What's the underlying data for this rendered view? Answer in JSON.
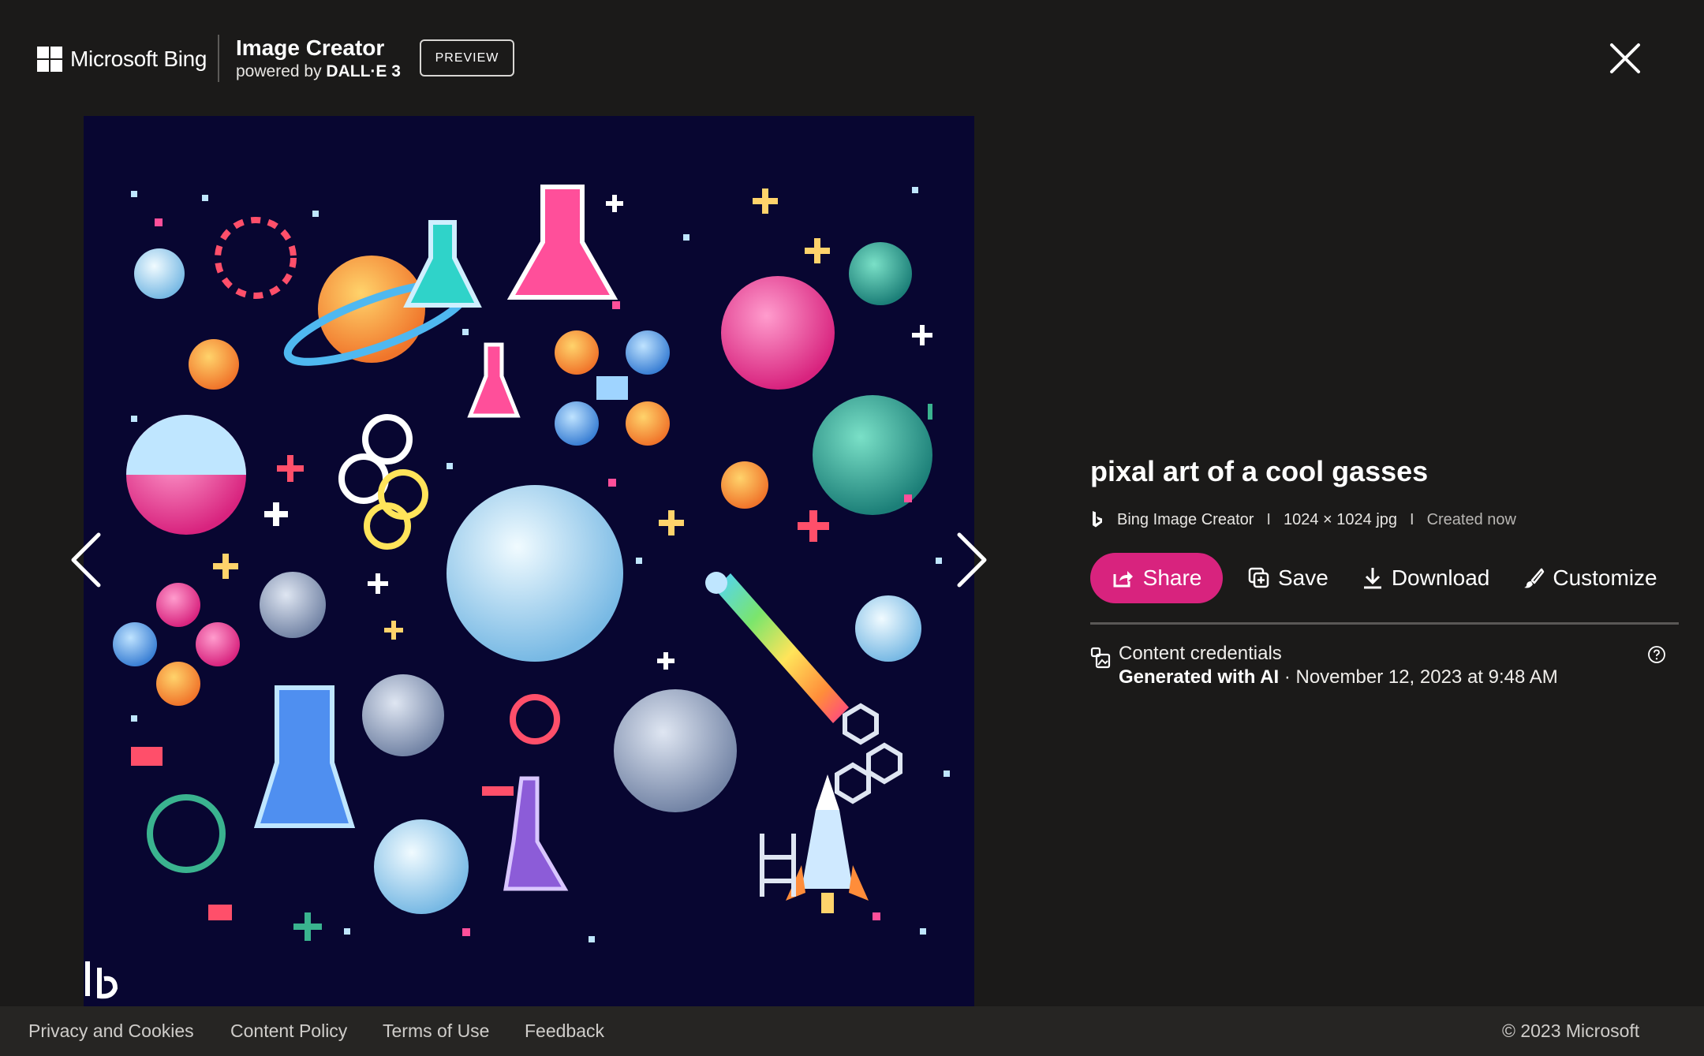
{
  "header": {
    "brand": "Microsoft Bing",
    "product_title": "Image Creator",
    "powered_prefix": "powered by",
    "powered_model": "DALL·E 3",
    "badge": "PREVIEW"
  },
  "image": {
    "watermark_icon": "bing-b-icon"
  },
  "details": {
    "title": "pixal art of a cool gasses",
    "source": "Bing Image Creator",
    "size": "1024 × 1024 jpg",
    "created": "Created now",
    "separator": "I",
    "actions": {
      "share": "Share",
      "save": "Save",
      "download": "Download",
      "customize": "Customize"
    },
    "credentials": {
      "label": "Content credentials",
      "generated": "Generated with AI",
      "date": " · November 12, 2023 at 9:48 AM"
    }
  },
  "footer": {
    "links": [
      "Privacy and Cookies",
      "Content Policy",
      "Terms of Use",
      "Feedback"
    ],
    "copyright": "© 2023 Microsoft"
  },
  "colors": {
    "background": "#1b1a19",
    "accent": "#d8237e",
    "image_bg": "#080631"
  }
}
